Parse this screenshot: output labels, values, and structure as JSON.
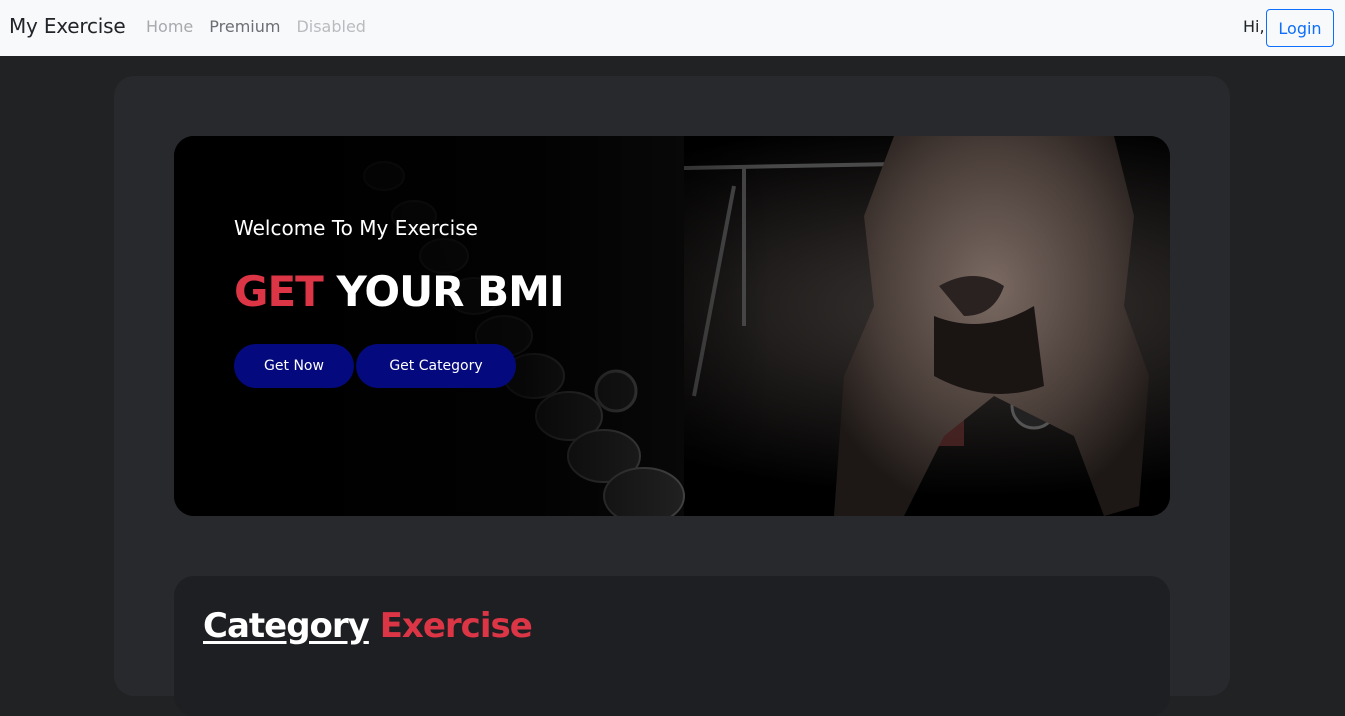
{
  "navbar": {
    "brand": "My Exercise",
    "links": [
      {
        "label": "Home"
      },
      {
        "label": "Premium"
      },
      {
        "label": "Disabled"
      }
    ],
    "greeting": "Hi,",
    "login_label": "Login"
  },
  "hero": {
    "welcome": "Welcome To My Exercise",
    "title_red": "GET",
    "title_white": "YOUR BMI",
    "buttons": {
      "get_now": "Get Now",
      "get_category": "Get Category"
    }
  },
  "category": {
    "title_white": "Category",
    "title_red": "Exercise"
  },
  "colors": {
    "accent_red": "#dc3545",
    "button_navy": "#040a7d",
    "login_blue": "#0d6efd"
  }
}
